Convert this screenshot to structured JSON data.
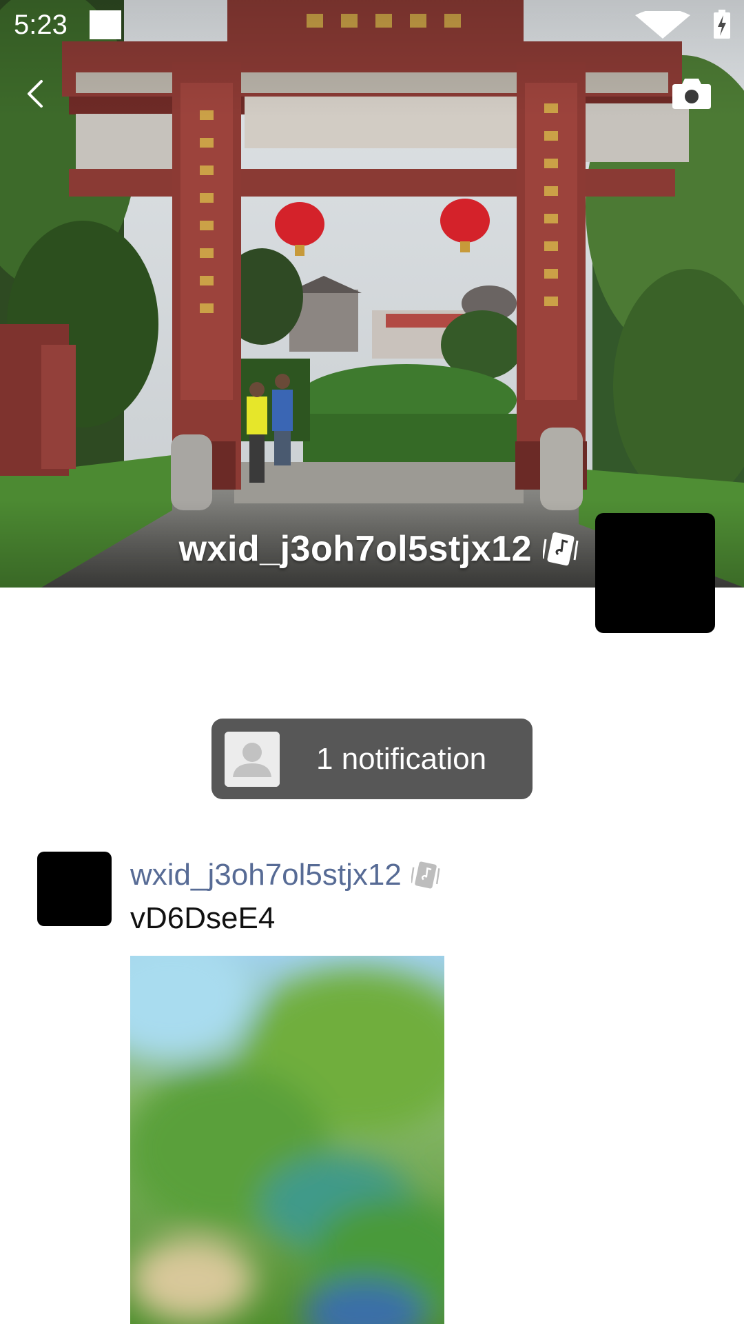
{
  "status_bar": {
    "time": "5:23"
  },
  "nav": {
    "back_icon": "chevron-left-icon",
    "camera_icon": "camera-icon"
  },
  "cover": {
    "username": "wxid_j3oh7ol5stjx12",
    "music_badge_icon": "music-card-icon"
  },
  "notification": {
    "label": "1 notification",
    "avatar_icon": "default-person-icon"
  },
  "post": {
    "author": "wxid_j3oh7ol5stjx12",
    "text": "vD6DseE4",
    "author_badge_icon": "music-card-icon"
  },
  "colors": {
    "notification_bg": "#575757",
    "author_link": "#576b95",
    "status_text": "#ffffff"
  }
}
